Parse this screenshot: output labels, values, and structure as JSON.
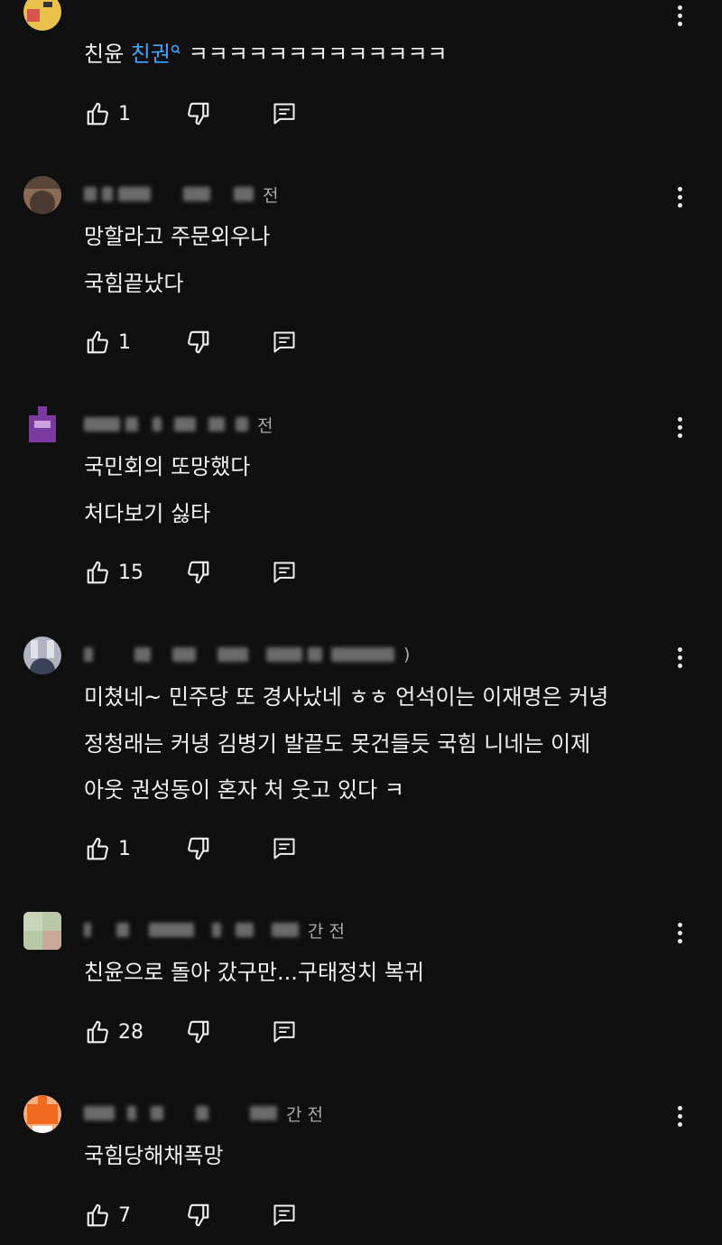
{
  "colors": {
    "background": "#0f0f0f",
    "text": "#f1f1f1",
    "link": "#3ea6ff",
    "muted": "#aaaaaa"
  },
  "comments": [
    {
      "avatar_colors": [
        "#e8c24a",
        "#d9534f"
      ],
      "time_suffix": "",
      "lines": [
        {
          "parts": [
            {
              "text": "친윤 ",
              "link": false
            },
            {
              "text": "친권",
              "link": true
            },
            {
              "text": "  ㅋㅋㅋㅋㅋㅋㅋㅋㅋㅋㅋㅋㅋ",
              "link": false
            }
          ]
        }
      ],
      "likes": "1"
    },
    {
      "avatar_colors": [
        "#4a3a30",
        "#8a6a55"
      ],
      "time_suffix": "전",
      "lines": [
        {
          "parts": [
            {
              "text": "망할라고 주문외우나",
              "link": false
            }
          ]
        },
        {
          "parts": [
            {
              "text": "국힘끝났다",
              "link": false
            }
          ]
        }
      ],
      "likes": "1"
    },
    {
      "avatar_colors": [
        "#7a3aa0",
        "#c9a0e0"
      ],
      "time_suffix": "전",
      "lines": [
        {
          "parts": [
            {
              "text": "국민회의  또망했다",
              "link": false
            }
          ]
        },
        {
          "parts": [
            {
              "text": "처다보기  싫타",
              "link": false
            }
          ]
        }
      ],
      "likes": "15"
    },
    {
      "avatar_colors": [
        "#b0b4c0",
        "#3a4258"
      ],
      "time_suffix": ")",
      "lines": [
        {
          "parts": [
            {
              "text": "미쳤네~ 민주당 또 경사났네 ㅎㅎ 언석이는 이재명은 커녕",
              "link": false
            }
          ]
        },
        {
          "parts": [
            {
              "text": "정청래는 커녕 김병기 발끝도 못건들듯 국힘 니네는 이제",
              "link": false
            }
          ]
        },
        {
          "parts": [
            {
              "text": "아웃 권성동이 혼자 처 웃고 있다 ㅋ",
              "link": false
            }
          ]
        }
      ],
      "likes": "1"
    },
    {
      "avatar_colors": [
        "#b9c9a8",
        "#c9a89a"
      ],
      "time_suffix": "간 전",
      "lines": [
        {
          "parts": [
            {
              "text": "친윤으로 돌아 갔구만...구태정치 복귀",
              "link": false
            }
          ]
        }
      ],
      "likes": "28"
    },
    {
      "avatar_colors": [
        "#f06a20",
        "#f7b080"
      ],
      "time_suffix": "간 전",
      "lines": [
        {
          "parts": [
            {
              "text": "국힘당해채폭망",
              "link": false
            }
          ]
        }
      ],
      "likes": "7"
    }
  ]
}
